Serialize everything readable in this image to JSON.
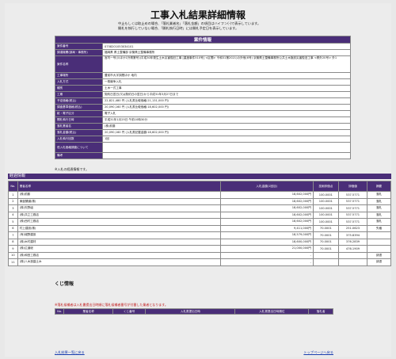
{
  "title": "工事入札結果詳細情報",
  "notes": [
    "中止もしくは取止めの場合、「落札業者名」「落札金額」の項目はハイフン(-)で表示しています。",
    "開札を執行していない場合、「開札執行日時」には開札予定日を表示しています。"
  ],
  "info": {
    "header": "案件情報",
    "rows": [
      {
        "label": "案件番号",
        "value": "0758201053034101"
      },
      {
        "label": "調達機関(部局・事務所)",
        "value": "福岡県 県土整備部 京築県土整備事務所"
      },
      {
        "label": "案件名称",
        "value": "宮内一号(川ほか1外県第号)(平成30年発生土木災害復旧工事 [重度事件510号] <区間> 令和31第2021)の外他(6号) 京築県土整備事務所公共土木施設災害復旧工事 <県外20号> 外1"
      },
      {
        "label": "工事場所",
        "value": "豊前市大字挟間ほか 地内"
      },
      {
        "label": "入札方式",
        "value": "一般競争入札"
      },
      {
        "label": "種別",
        "value": "土木一式工事"
      },
      {
        "label": "工期",
        "value": "契約日翌日(又は契約日の翌日)から平成31年3月27日まで"
      },
      {
        "label": "予定価格(税込)",
        "value": "22,821,480 円 (入札書比較価格:21,131,000 円)"
      },
      {
        "label": "調査基準価格(税込)",
        "value": "20,090,160 円 (入札書比較価格:18,602,000 円)"
      },
      {
        "label": "紙・電子区分",
        "value": "電子入札"
      },
      {
        "label": "開札執行日時",
        "value": "平成31年1月25日 午前10時30分"
      },
      {
        "label": "落札業者名",
        "value": "(株)前藤"
      },
      {
        "label": "落札金額(税込)",
        "value": "20,090,160 円 (入札書記載金額:18,602,000 円)"
      },
      {
        "label": "入札執行回数",
        "value": "1回"
      },
      {
        "label": "低入札価格調査について",
        "value": ""
      },
      {
        "label": "備考",
        "value": ""
      }
    ]
  },
  "note_below": "※入札の経過情報です。",
  "bids": {
    "section": "経過情報",
    "columns": [
      "No.",
      "業者名称",
      "入札金額(1回目)",
      "技術評価点",
      "評価値",
      "摘要"
    ],
    "rows": [
      {
        "no": "1",
        "name": "(株)前藤",
        "amount": "18,602,000円",
        "score": "100.0001",
        "value": "537.5771",
        "note": "落札"
      },
      {
        "no": "2",
        "name": "東亜舗道(株)",
        "amount": "18,602,000円",
        "score": "100.0001",
        "value": "537.5771",
        "note": "落札"
      },
      {
        "no": "3",
        "name": "(株)矢野組",
        "amount": "18,602,000円",
        "score": "100.0001",
        "value": "537.5771",
        "note": "落札"
      },
      {
        "no": "4",
        "name": "(株)共立工務店",
        "amount": "18,602,000円",
        "score": "100.0001",
        "value": "537.5771",
        "note": "落札"
      },
      {
        "no": "5",
        "name": "(株)西村工務店",
        "amount": "18,602,000円",
        "score": "100.0001",
        "value": "537.5771",
        "note": "落札"
      },
      {
        "no": "6",
        "name": "村上建設(株)",
        "amount": "9,411,000円",
        "score": "70.0001",
        "value": "251.0623",
        "note": "失格"
      },
      {
        "no": "7",
        "name": "(有)城野建設",
        "amount": "18,579,000円",
        "score": "70.0001",
        "value": "375.8394",
        "note": ""
      },
      {
        "no": "8",
        "name": "(株)木村建材",
        "amount": "18,600,000円",
        "score": "70.0001",
        "value": "376.2839",
        "note": ""
      },
      {
        "no": "9",
        "name": "(株)広道総",
        "amount": "21,000,000円",
        "score": "70.0001",
        "value": "476.1909",
        "note": ""
      },
      {
        "no": "10",
        "name": "(株)和田工務店",
        "amount": "-",
        "score": "",
        "value": "",
        "note": "辞退"
      },
      {
        "no": "11",
        "name": "(株)八木造園土木",
        "amount": "-",
        "score": "",
        "value": "",
        "note": "辞退"
      }
    ]
  },
  "lottery": {
    "title": "くじ情報",
    "rows": [
      {
        "no": "1",
        "name": "(株)前藤",
        "num": "523",
        "time": "2019年01月20日 13時03分21秒",
        "rank": "2",
        "win": "○"
      },
      {
        "no": "2",
        "name": "東亜舗道(株)",
        "num": "298",
        "time": "2019年01月20日 13時03分21秒",
        "rank": "3",
        "win": ""
      },
      {
        "no": "3",
        "name": "(株)矢野組",
        "num": "92",
        "time": "2019年01月22日 10時49分13秒",
        "rank": "1",
        "win": ""
      },
      {
        "no": "4",
        "name": "(株)共立工務店",
        "num": "160",
        "time": "2019年01月23日 10時49分52秒",
        "rank": "4",
        "win": ""
      },
      {
        "no": "5",
        "name": "(株)西村工務店",
        "num": "879",
        "time": "2019年01月23日 14時22分28秒",
        "rank": "5",
        "win": ""
      }
    ],
    "warning": "※落札候補者は入札書提出日時順に落札候補者番号が付番した業者となります。",
    "columns": [
      "No.",
      "業者名称",
      "くじ番号",
      "入札書提出日時",
      "入札書提出日時順位",
      "落札者"
    ]
  },
  "links": {
    "back": "入札結果一覧に戻る",
    "top": "トップページへ戻る"
  },
  "colors": {
    "header_purple": "#4a2e78",
    "warning_red": "#c01a1a",
    "link_blue": "#1a3fb0"
  }
}
